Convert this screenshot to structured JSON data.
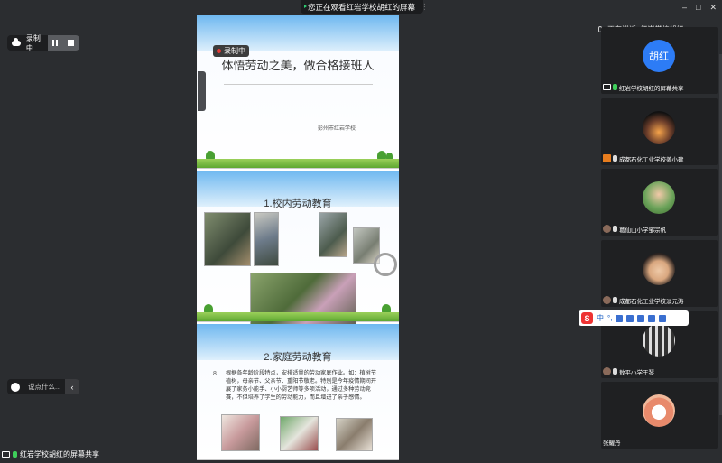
{
  "top_banner": {
    "text": "您正在观看红岩学校胡红的屏幕"
  },
  "window_controls": [
    "–",
    "□",
    "✕"
  ],
  "recording_pill": {
    "label": "录制中"
  },
  "slides": {
    "s1": {
      "rec_tag": "录制中",
      "title": "体悟劳动之美，做合格接班人",
      "school": "彭州市红岩学校"
    },
    "s2": {
      "title": "1.校内劳动教育"
    },
    "s3": {
      "title": "2.家庭劳动教育",
      "marker": "8",
      "body": "根据各年龄阶段特点，安排适量的劳动家庭作业。如：植树节植树，母亲节、父亲节、重阳节敬老。特别是今年疫情期间开展了家务小能手、小小厨艺师等多项活动，通过多种劳动竞赛，不但培养了学生的劳动能力，而且增进了亲子感情。"
    }
  },
  "speaking": {
    "label": "正在讲话: 红岩学校胡红;"
  },
  "participants": [
    {
      "name": "红岩学校胡红的屏幕共享",
      "avatar_text": "胡红"
    },
    {
      "name": "成都石化工业学校姜小建"
    },
    {
      "name": "葛仙山小学邹宗帆"
    },
    {
      "name": "成都石化工业学校淡元涛"
    },
    {
      "name": "敖平小学王琴"
    },
    {
      "name": "张耀丹"
    }
  ],
  "ime_bar": {
    "logo": "S",
    "mode": "中",
    "punct": "°,"
  },
  "chat": {
    "placeholder": "说点什么...",
    "arrow": "‹"
  },
  "bottom_share": {
    "label": "红岩学校胡红的屏幕共享"
  }
}
